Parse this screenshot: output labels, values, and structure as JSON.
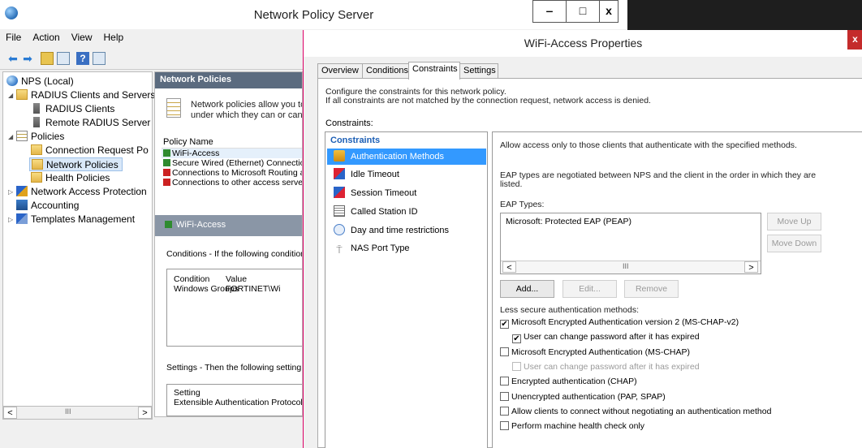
{
  "mmc": {
    "title": "Network Policy Server",
    "caption_minimize": "‒",
    "caption_maximize": "□",
    "caption_close": "x",
    "menu": [
      "File",
      "Action",
      "View",
      "Help"
    ],
    "tree": {
      "root": "NPS (Local)",
      "radius_clients_servers": "RADIUS Clients and Servers",
      "radius_clients": "RADIUS Clients",
      "remote_radius": "Remote RADIUS Server",
      "policies": "Policies",
      "connection_request": "Connection Request Po",
      "network_policies": "Network Policies",
      "health_policies": "Health Policies",
      "nap": "Network Access Protection",
      "accounting": "Accounting",
      "templates": "Templates Management"
    },
    "scroll_thumb": "III",
    "middle": {
      "header": "Network Policies",
      "info_line1": "Network policies allow you to",
      "info_line2": "under which they can or cann",
      "column_policy_name": "Policy Name",
      "policies": [
        {
          "name": "WiFi-Access",
          "status": "ok"
        },
        {
          "name": "Secure Wired (Ethernet) Connectio",
          "status": "ok"
        },
        {
          "name": "Connections to Microsoft Routing a",
          "status": "no"
        },
        {
          "name": "Connections to other access serve",
          "status": "no"
        }
      ],
      "selected_band": "WiFi-Access",
      "conditions_text": "Conditions - If the following condition",
      "cond_col_condition": "Condition",
      "cond_col_value": "Value",
      "cond_row_condition": "Windows Groups",
      "cond_row_value": "FORTINET\\Wi",
      "settings_text": "Settings - Then the following setting",
      "settings_col": "Setting",
      "settings_row": "Extensible Authentication Protocol"
    }
  },
  "dialog": {
    "title": "WiFi-Access Properties",
    "close": "x",
    "tabs": [
      "Overview",
      "Conditions",
      "Constraints",
      "Settings"
    ],
    "active_tab": "Constraints",
    "description_line1": "Configure the constraints for this network policy.",
    "description_line2": "If all constraints are not matched by the connection request, network access is denied.",
    "constraints_label": "Constraints:",
    "list_header": "Constraints",
    "items": [
      "Authentication Methods",
      "Idle Timeout",
      "Session Timeout",
      "Called Station ID",
      "Day and time restrictions",
      "NAS Port Type"
    ],
    "selected_item": "Authentication Methods",
    "detail": {
      "allow_text": "Allow access only to those clients that authenticate with the specified methods.",
      "eap_line1": "EAP types are negotiated between NPS and the client in the order in which they are",
      "eap_line2": "listed.",
      "eap_types_label": "EAP Types:",
      "eap_types": [
        "Microsoft: Protected EAP (PEAP)"
      ],
      "scroll_left": "<",
      "scroll_thumb": "III",
      "scroll_right": ">",
      "move_up": "Move Up",
      "move_down": "Move Down",
      "add": "Add...",
      "edit": "Edit...",
      "remove": "Remove",
      "less_secure_label": "Less secure authentication methods:",
      "checkboxes": [
        {
          "label": "Microsoft Encrypted Authentication version 2 (MS-CHAP-v2)",
          "checked": true,
          "enabled": true,
          "indent": false
        },
        {
          "label": "User can change password after it has expired",
          "checked": true,
          "enabled": true,
          "indent": true
        },
        {
          "label": "Microsoft Encrypted Authentication (MS-CHAP)",
          "checked": false,
          "enabled": true,
          "indent": false
        },
        {
          "label": "User can change password after it has expired",
          "checked": false,
          "enabled": false,
          "indent": true
        },
        {
          "label": "Encrypted authentication (CHAP)",
          "checked": false,
          "enabled": true,
          "indent": false
        },
        {
          "label": "Unencrypted authentication (PAP, SPAP)",
          "checked": false,
          "enabled": true,
          "indent": false
        },
        {
          "label": "Allow clients to connect without negotiating an authentication method",
          "checked": false,
          "enabled": true,
          "indent": false
        },
        {
          "label": "Perform machine health check only",
          "checked": false,
          "enabled": true,
          "indent": false
        }
      ]
    }
  },
  "colors": {
    "selection": "#3399ff",
    "header_blue": "#1c5fb5",
    "close_red": "#c42b2b"
  }
}
